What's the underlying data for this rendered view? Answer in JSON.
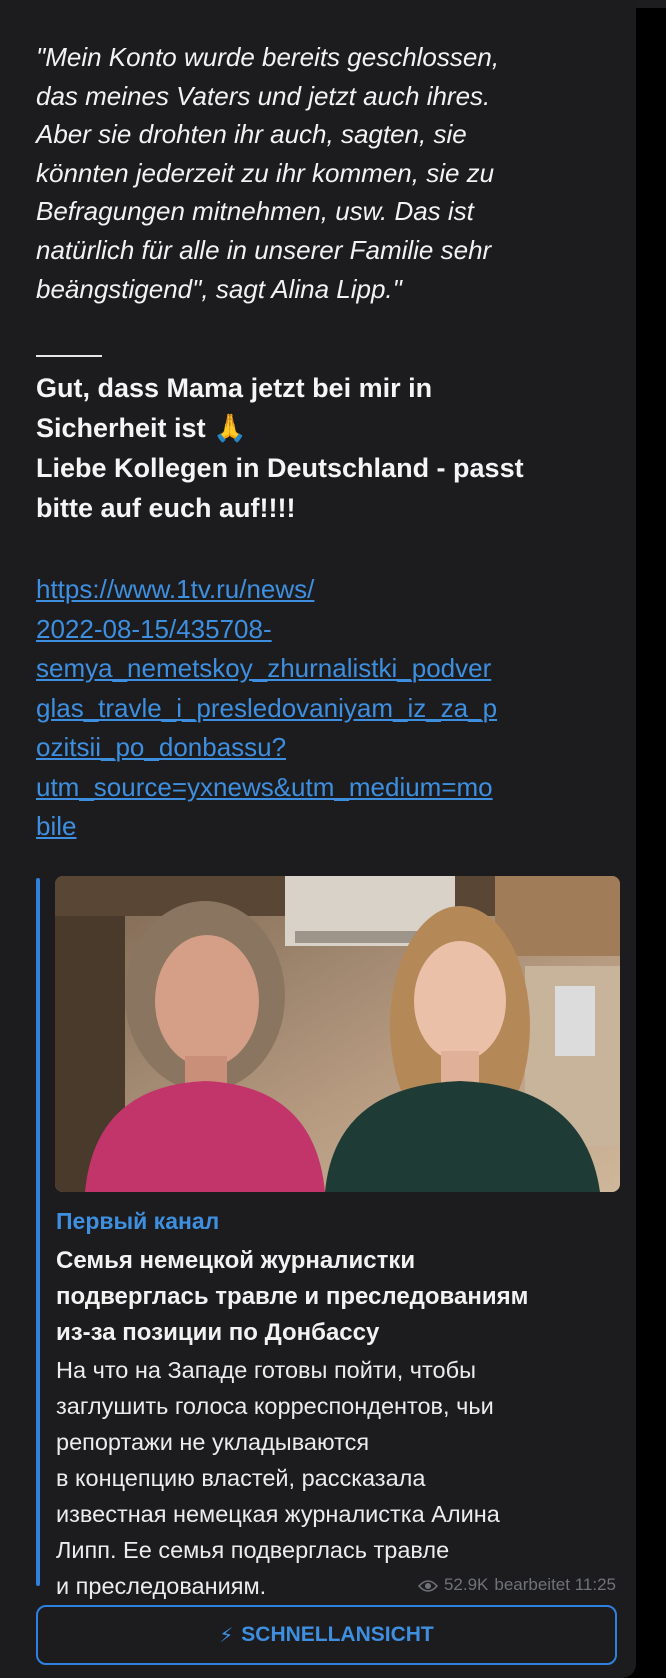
{
  "quote": {
    "lines": [
      "\"Mein Konto wurde bereits geschlossen,",
      "das meines Vaters und jetzt auch ihres.",
      "Aber sie drohten ihr auch, sagten, sie",
      "könnten jederzeit zu ihr kommen, sie zu",
      "Befragungen mitnehmen, usw. Das ist",
      "natürlich für alle in unserer Familie sehr",
      "beängstigend\", sagt Alina Lipp.\""
    ]
  },
  "message": {
    "line1": "Gut, dass Mama jetzt bei mir in",
    "line2": "Sicherheit ist",
    "emoji": "🙏",
    "line3": "Liebe Kollegen in Deutschland - passt",
    "line4": "bitte auf euch auf!!!!"
  },
  "link": {
    "lines": [
      "https://www.1tv.ru/news/",
      "2022-08-15/435708-",
      "semya_nemetskoy_zhurnalistki_podver",
      "glas_travle_i_presledovaniyam_iz_za_p",
      "ozitsii_po_donbassu?",
      "utm_source=yxnews&utm_medium=mo",
      "bile"
    ]
  },
  "preview": {
    "site_name": "Первый канал",
    "title_lines": [
      "Семья немецкой журналистки",
      "подверглась травле и преследованиям",
      "из-за позиции по Донбассу"
    ],
    "description_lines": [
      "На что на Западе готовы пойти, чтобы",
      "заглушить голоса корреспондентов, чьи",
      "репортажи не укладываются",
      "в концепцию властей, рассказала",
      "известная немецкая журналистка Алина",
      "Липп. Ее семья подверглась травле",
      "и преследованиям."
    ]
  },
  "meta": {
    "views": "52.9K",
    "edited_time": "bearbeitet 11:25"
  },
  "quickview": {
    "label": "SCHNELLANSICHT",
    "icon": "lightning-bolt-icon"
  },
  "colors": {
    "background": "#000000",
    "bubble": "#1c1c1e",
    "accent": "#2f81df",
    "link": "#3e8fe0",
    "text": "#f2f2f2",
    "meta": "#6f7278"
  }
}
